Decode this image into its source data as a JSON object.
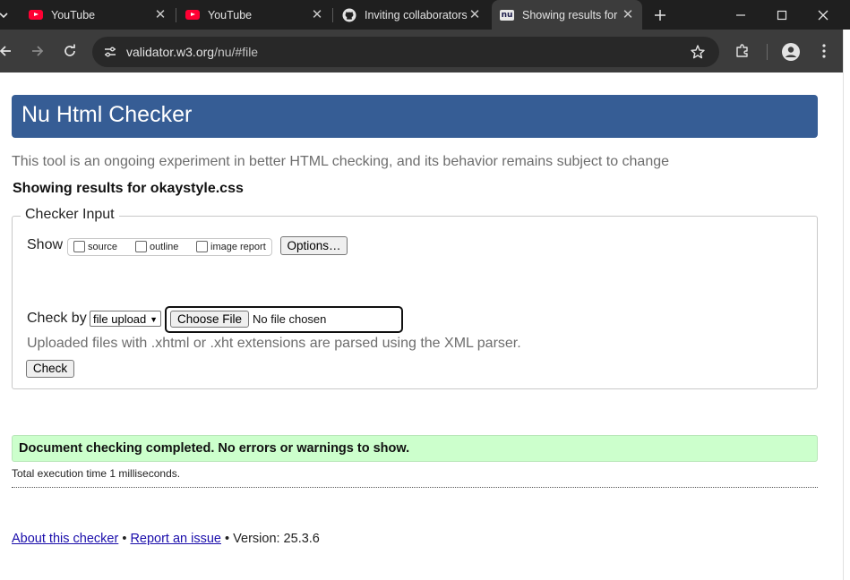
{
  "browser": {
    "tabs": [
      {
        "title": "YouTube",
        "icon": "youtube-icon"
      },
      {
        "title": "YouTube",
        "icon": "youtube-icon"
      },
      {
        "title": "Inviting collaborators",
        "icon": "github-icon"
      },
      {
        "title": "Showing results for",
        "icon": "nu-icon",
        "favicon_text": "nu",
        "active": true
      }
    ],
    "url_host": "validator.w3.org",
    "url_path": "/nu/#file"
  },
  "page": {
    "header_title": "Nu Html Checker",
    "intro": "This tool is an ongoing experiment in better HTML checking, and its behavior remains subject to change",
    "showing_results": "Showing results for okaystyle.css",
    "checker_input": {
      "legend": "Checker Input",
      "show_label": "Show",
      "checkboxes": [
        {
          "label": "source",
          "checked": false
        },
        {
          "label": "outline",
          "checked": false
        },
        {
          "label": "image report",
          "checked": false
        }
      ],
      "options_button": "Options…",
      "check_by_label": "Check by",
      "check_by_value": "file upload",
      "choose_file_button": "Choose File",
      "no_file_text": "No file chosen",
      "xml_note": "Uploaded files with .xhtml or .xht extensions are parsed using the XML parser.",
      "check_button": "Check"
    },
    "result_message": "Document checking completed. No errors or warnings to show.",
    "execution_time": "Total execution time 1 milliseconds.",
    "footer": {
      "about_link": "About this checker",
      "separator": "•",
      "report_link": "Report an issue",
      "version": "Version: 25.3.6"
    }
  },
  "colors": {
    "header_bg": "#365d95",
    "success_bg": "#ccffcc",
    "link": "#1a0dab"
  }
}
